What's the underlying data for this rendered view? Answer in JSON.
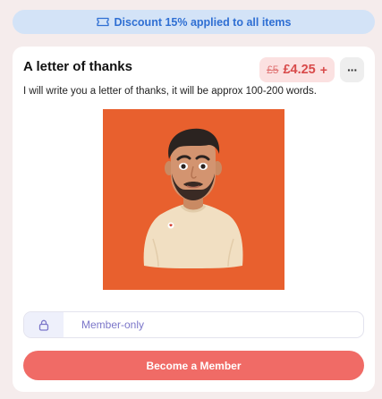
{
  "banner": {
    "text": "Discount 15% applied to all items",
    "icon": "ticket-icon"
  },
  "item": {
    "title": "A letter of thanks",
    "price_original": "£5",
    "price_current": "£4.25",
    "price_suffix": "+",
    "more_label": "···",
    "description": "I will write you a letter of thanks, it will be approx 100-200 words."
  },
  "membership": {
    "label": "Member-only",
    "icon": "lock-icon",
    "button_label": "Become a Member"
  },
  "colors": {
    "banner_bg": "#d3e3f7",
    "banner_text": "#2f6fd3",
    "price_bg": "#fbe1e1",
    "price_text": "#d84a4a",
    "image_bg": "#e8602e",
    "button_bg": "#f06b66",
    "member_text": "#7b76c9"
  }
}
